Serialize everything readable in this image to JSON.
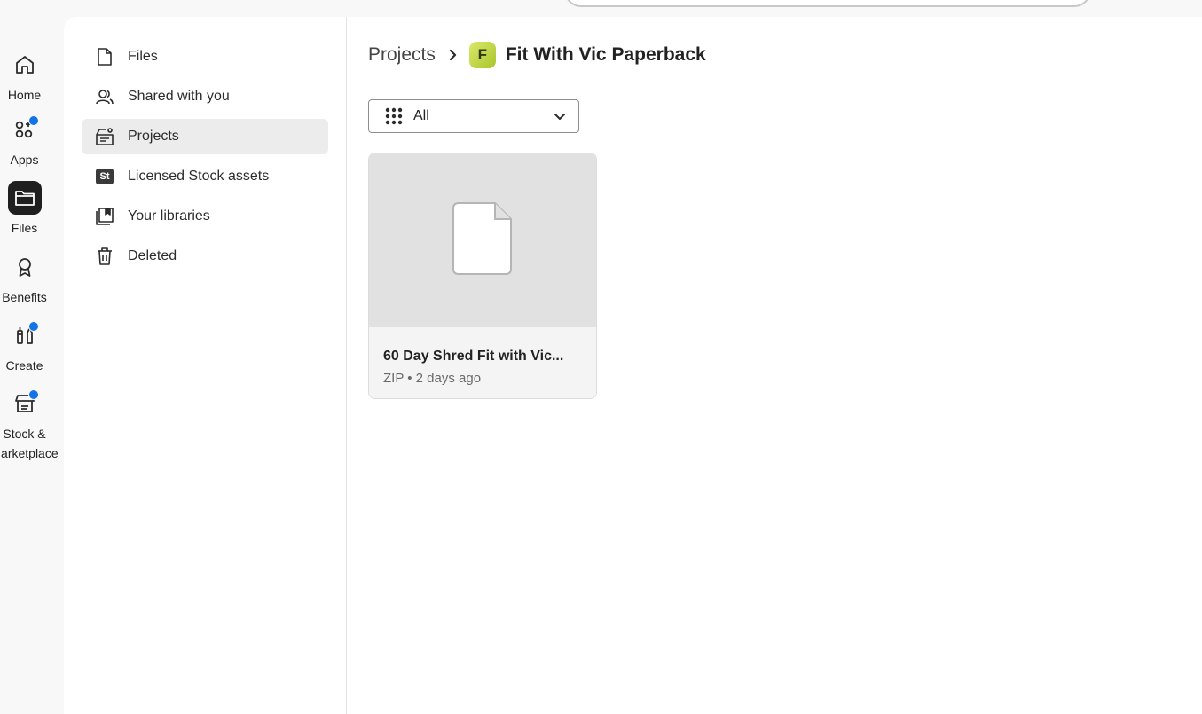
{
  "rail": {
    "items": [
      {
        "label": "Home",
        "icon": "home-icon",
        "badge": false,
        "active": false
      },
      {
        "label": "Apps",
        "icon": "apps-icon",
        "badge": true,
        "active": false
      },
      {
        "label": "Files",
        "icon": "folder-icon",
        "badge": false,
        "active": true
      },
      {
        "label": "Benefits",
        "icon": "award-icon",
        "badge": false,
        "active": false
      },
      {
        "label": "Create",
        "icon": "create-icon",
        "badge": true,
        "active": false
      },
      {
        "label_line1": "Stock &",
        "label_line2": "Marketplace",
        "icon": "stock-marketplace-icon",
        "badge": true,
        "active": false
      }
    ]
  },
  "subnav": {
    "items": [
      {
        "label": "Files",
        "icon": "file-icon"
      },
      {
        "label": "Shared with you",
        "icon": "people-icon"
      },
      {
        "label": "Projects",
        "icon": "projects-icon",
        "active": true
      },
      {
        "label": "Licensed Stock assets",
        "icon": "stock-icon",
        "badge_text": "St"
      },
      {
        "label": "Your libraries",
        "icon": "libraries-icon"
      },
      {
        "label": "Deleted",
        "icon": "trash-icon"
      }
    ]
  },
  "breadcrumb": {
    "root": "Projects",
    "avatar_letter": "F",
    "current": "Fit With Vic Paperback"
  },
  "filter": {
    "selected": "All"
  },
  "files": [
    {
      "name": "60 Day Shred Fit with Vic...",
      "meta": "ZIP • 2 days ago",
      "icon": "generic-file-icon"
    }
  ],
  "colors": {
    "accent_blue": "#1473e6",
    "active_rail_bg": "#1f1f1f",
    "project_avatar": "#c4d94a"
  }
}
